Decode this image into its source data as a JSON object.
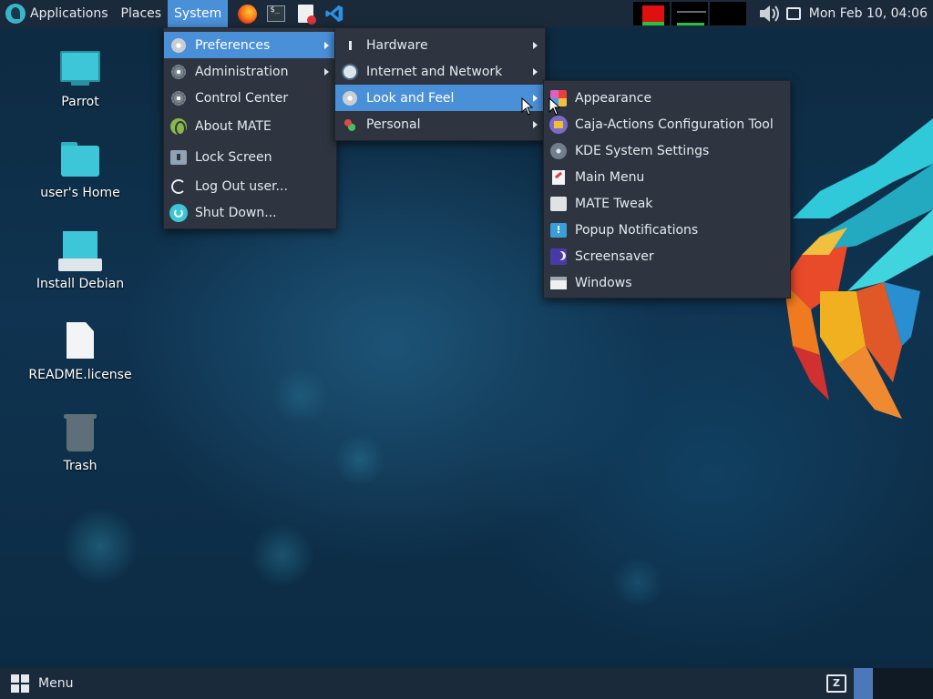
{
  "top_panel": {
    "menus": {
      "applications": "Applications",
      "places": "Places",
      "system": "System"
    },
    "launchers": [
      "firefox-icon",
      "terminal-icon",
      "screenshot-icon",
      "vscode-icon"
    ],
    "clock": "Mon Feb 10, 04:06"
  },
  "desktop": {
    "icons": [
      {
        "label": "Parrot",
        "icon": "computer-icon"
      },
      {
        "label": "user's Home",
        "icon": "home-folder-icon"
      },
      {
        "label": "Install Debian",
        "icon": "installer-icon"
      },
      {
        "label": "README.license",
        "icon": "document-icon"
      },
      {
        "label": "Trash",
        "icon": "trash-icon"
      }
    ]
  },
  "system_menu": {
    "items": [
      {
        "label": "Preferences",
        "submenu": true
      },
      {
        "label": "Administration",
        "submenu": true
      },
      {
        "label": "Control Center"
      },
      {
        "label": "About MATE"
      },
      {
        "label": "Lock Screen"
      },
      {
        "label": "Log Out user..."
      },
      {
        "label": "Shut Down..."
      }
    ]
  },
  "preferences_menu": {
    "items": [
      {
        "label": "Hardware"
      },
      {
        "label": "Internet and Network"
      },
      {
        "label": "Look and Feel"
      },
      {
        "label": "Personal"
      }
    ]
  },
  "look_and_feel_menu": {
    "items": [
      {
        "label": "Appearance"
      },
      {
        "label": "Caja-Actions Configuration Tool"
      },
      {
        "label": "KDE System Settings"
      },
      {
        "label": "Main Menu"
      },
      {
        "label": "MATE Tweak"
      },
      {
        "label": "Popup Notifications"
      },
      {
        "label": "Screensaver"
      },
      {
        "label": "Windows"
      }
    ]
  },
  "bottom_panel": {
    "menu_label": "Menu",
    "keyboard_indicator": "Z"
  },
  "colors": {
    "panel": "#1b2a3a",
    "menu_bg": "#2e3540",
    "highlight": "#4a90d9",
    "accent_cyan": "#3cc6d8"
  }
}
